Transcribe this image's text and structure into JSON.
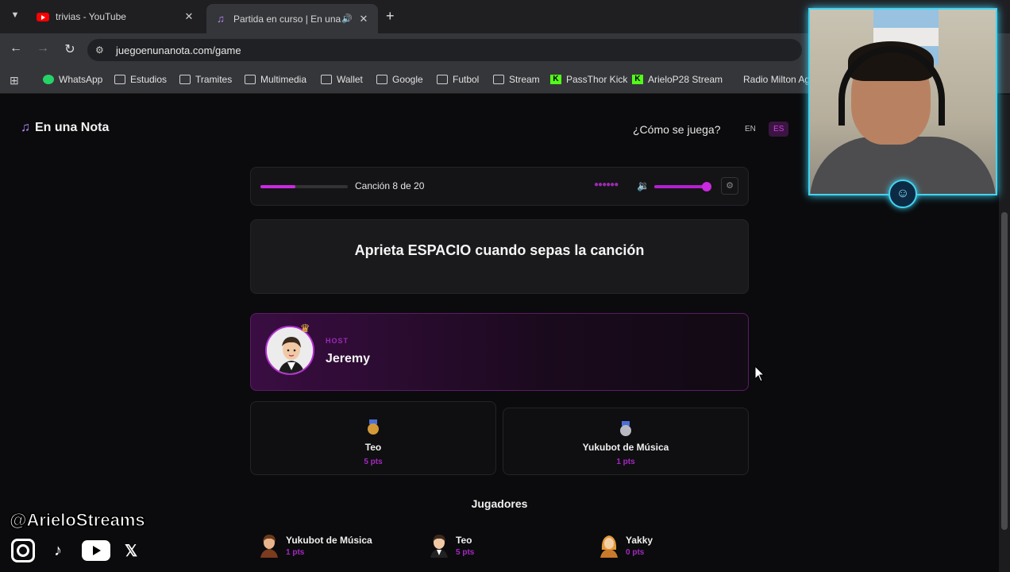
{
  "browser": {
    "tabs": [
      {
        "title": "trivias - YouTube",
        "close": "✕"
      },
      {
        "title": "Partida en curso | En una Nota",
        "close": "✕"
      }
    ],
    "new_tab": "+",
    "url": "juegoenunanota.com/game",
    "bookmarks": [
      "WhatsApp",
      "Estudios",
      "Tramites",
      "Multimedia",
      "Wallet",
      "Google",
      "Futbol",
      "Stream",
      "PassThor Kick",
      "ArieloP28 Stream",
      "Radio Milton Ag"
    ]
  },
  "site": {
    "brand": "En una Nota",
    "how_to_play": "¿Cómo se juega?",
    "lang_en": "EN",
    "lang_es": "ES"
  },
  "game": {
    "song_counter": "Canción 8 de 20",
    "song_progress_pct": 40,
    "volume_pct": 90,
    "prompt": "Aprieta ESPACIO cuando sepas la canción",
    "host_label": "HOST",
    "host_name": "Jeremy",
    "leaderboard": [
      {
        "name": "Teo",
        "points": "5 pts",
        "medal_color": "#d49a3a"
      },
      {
        "name": "Yukubot de Música",
        "points": "1 pts",
        "medal_color": "#b9b9c4"
      }
    ],
    "players_title": "Jugadores",
    "players": [
      {
        "name": "Yukubot de Música",
        "points": "1 pts"
      },
      {
        "name": "Teo",
        "points": "5 pts"
      },
      {
        "name": "Yakky",
        "points": "0 pts"
      }
    ]
  },
  "overlay": {
    "handle": "@ArieloStreams"
  },
  "colors": {
    "accent": "#c92ae0",
    "webcam_border": "#43d3f0"
  }
}
